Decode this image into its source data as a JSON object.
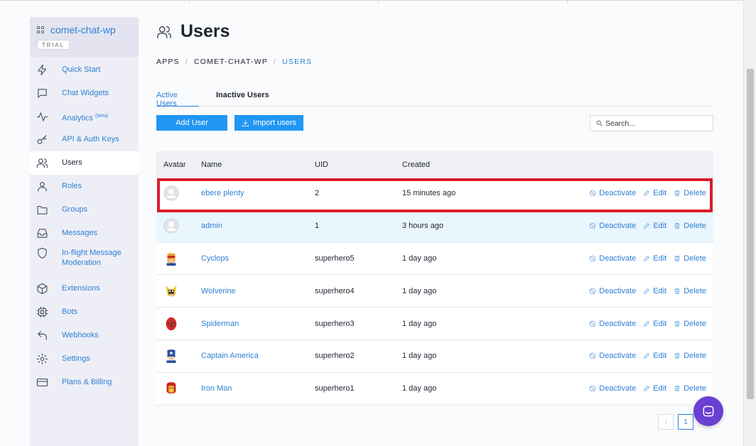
{
  "sidebar": {
    "app_name": "comet-chat-wp",
    "plan_badge": "TRIAL",
    "items": [
      {
        "label": "Quick Start",
        "icon": "bolt-icon"
      },
      {
        "label": "Chat Widgets",
        "icon": "chat-bubble-icon"
      },
      {
        "label": "Analytics",
        "badge": "(beta)",
        "icon": "activity-icon"
      },
      {
        "label": "API & Auth Keys",
        "icon": "key-icon"
      },
      {
        "label": "Users",
        "icon": "users-icon",
        "active": true
      },
      {
        "label": "Roles",
        "icon": "user-icon"
      },
      {
        "label": "Groups",
        "icon": "folder-icon"
      },
      {
        "label": "Messages",
        "icon": "inbox-icon"
      },
      {
        "label": "In-flight Message Moderation",
        "icon": "shield-icon"
      },
      {
        "label": "Extensions",
        "icon": "cube-icon"
      },
      {
        "label": "Bots",
        "icon": "cpu-icon"
      },
      {
        "label": "Webhooks",
        "icon": "reply-arrow-icon"
      },
      {
        "label": "Settings",
        "icon": "gear-icon"
      },
      {
        "label": "Plans & Billing",
        "icon": "credit-card-icon"
      }
    ]
  },
  "header": {
    "title": "Users",
    "breadcrumb": [
      "APPS",
      "COMET-CHAT-WP",
      "USERS"
    ]
  },
  "tabs": [
    {
      "label": "Active Users",
      "active": true
    },
    {
      "label": "Inactive Users",
      "active": false
    }
  ],
  "toolbar": {
    "add_user_label": "Add User",
    "import_users_label": "Import users",
    "search_placeholder": "Search..."
  },
  "table": {
    "columns": [
      "Avatar",
      "Name",
      "UID",
      "Created"
    ],
    "actions": {
      "deactivate": "Deactivate",
      "edit": "Edit",
      "delete": "Delete"
    },
    "rows": [
      {
        "avatar": "default-avatar",
        "name": "ebere plenty",
        "uid": "2",
        "created": "15 minutes ago"
      },
      {
        "avatar": "default-avatar",
        "name": "admin",
        "uid": "1",
        "created": "3 hours ago"
      },
      {
        "avatar": "cyclops-avatar",
        "name": "Cyclops",
        "uid": "superhero5",
        "created": "1 day ago"
      },
      {
        "avatar": "wolverine-avatar",
        "name": "Wolverine",
        "uid": "superhero4",
        "created": "1 day ago"
      },
      {
        "avatar": "spiderman-avatar",
        "name": "Spiderman",
        "uid": "superhero3",
        "created": "1 day ago"
      },
      {
        "avatar": "captain-america-avatar",
        "name": "Captain America",
        "uid": "superhero2",
        "created": "1 day ago"
      },
      {
        "avatar": "iron-man-avatar",
        "name": "Iron Man",
        "uid": "superhero1",
        "created": "1 day ago"
      }
    ]
  },
  "pagination": {
    "prev": "‹",
    "current": "1"
  },
  "colors": {
    "accent": "#2196f3",
    "link": "#2e7fd4",
    "highlight": "#d81e2c",
    "chat": "#6a3fd2"
  }
}
